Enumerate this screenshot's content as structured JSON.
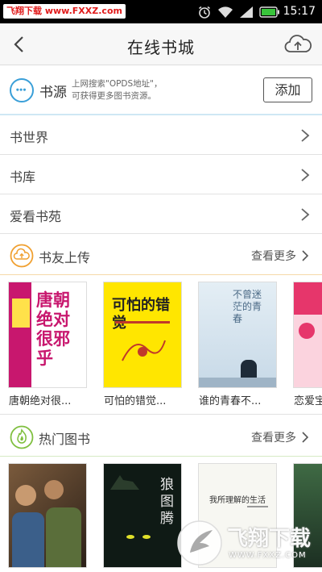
{
  "status_bar": {
    "badge": "飞翔下载 www.FXXZ.com",
    "time": "15:17"
  },
  "header": {
    "title": "在线书城",
    "back_icon": "back-arrow-icon",
    "cloud_icon": "cloud-upload-icon"
  },
  "source": {
    "title": "书源",
    "description_line1": "上网搜索\"OPDS地址\"，",
    "description_line2": "可获得更多图书资源。",
    "add_label": "添加",
    "icon": "more-dots-icon"
  },
  "menu": [
    {
      "label": "书世界"
    },
    {
      "label": "书库"
    },
    {
      "label": "爱看书苑"
    }
  ],
  "sections": {
    "upload": {
      "title": "书友上传",
      "more_label": "查看更多",
      "books": [
        {
          "title": "唐朝绝对很...",
          "cover_text": "唐朝绝对很邪乎",
          "colors": [
            "#ffffff",
            "#c8176e"
          ]
        },
        {
          "title": "可怕的错觉...",
          "cover_text": "可怕的错觉",
          "colors": [
            "#ffe600",
            "#222222"
          ]
        },
        {
          "title": "谁的青春不...",
          "cover_text": "不曾迷茫的青春",
          "colors": [
            "#dfeaf2",
            "#4b6a86"
          ]
        },
        {
          "title": "恋爱宝",
          "cover_text": "",
          "colors": [
            "#e6366b",
            "#fbd3de"
          ]
        }
      ]
    },
    "hot": {
      "title": "热门图书",
      "more_label": "查看更多",
      "books": [
        {
          "title": "",
          "cover_text": "",
          "colors": [
            "#7a5a3c",
            "#2b2018"
          ]
        },
        {
          "title": "",
          "cover_text": "狼图腾",
          "colors": [
            "#0f1a15",
            "#2b3d2c"
          ]
        },
        {
          "title": "",
          "cover_text": "我所理解的生活",
          "colors": [
            "#f7f7f2",
            "#333333"
          ]
        },
        {
          "title": "",
          "cover_text": "",
          "colors": [
            "#3f6a44",
            "#1c2f22"
          ]
        }
      ]
    }
  },
  "watermark": {
    "title": "飞翔下载",
    "url": "WWW.FXXZ.COM"
  },
  "colors": {
    "accent_blue": "#3a9fd8",
    "upload_orange": "#f0a030",
    "hot_green": "#7fbf3f"
  }
}
